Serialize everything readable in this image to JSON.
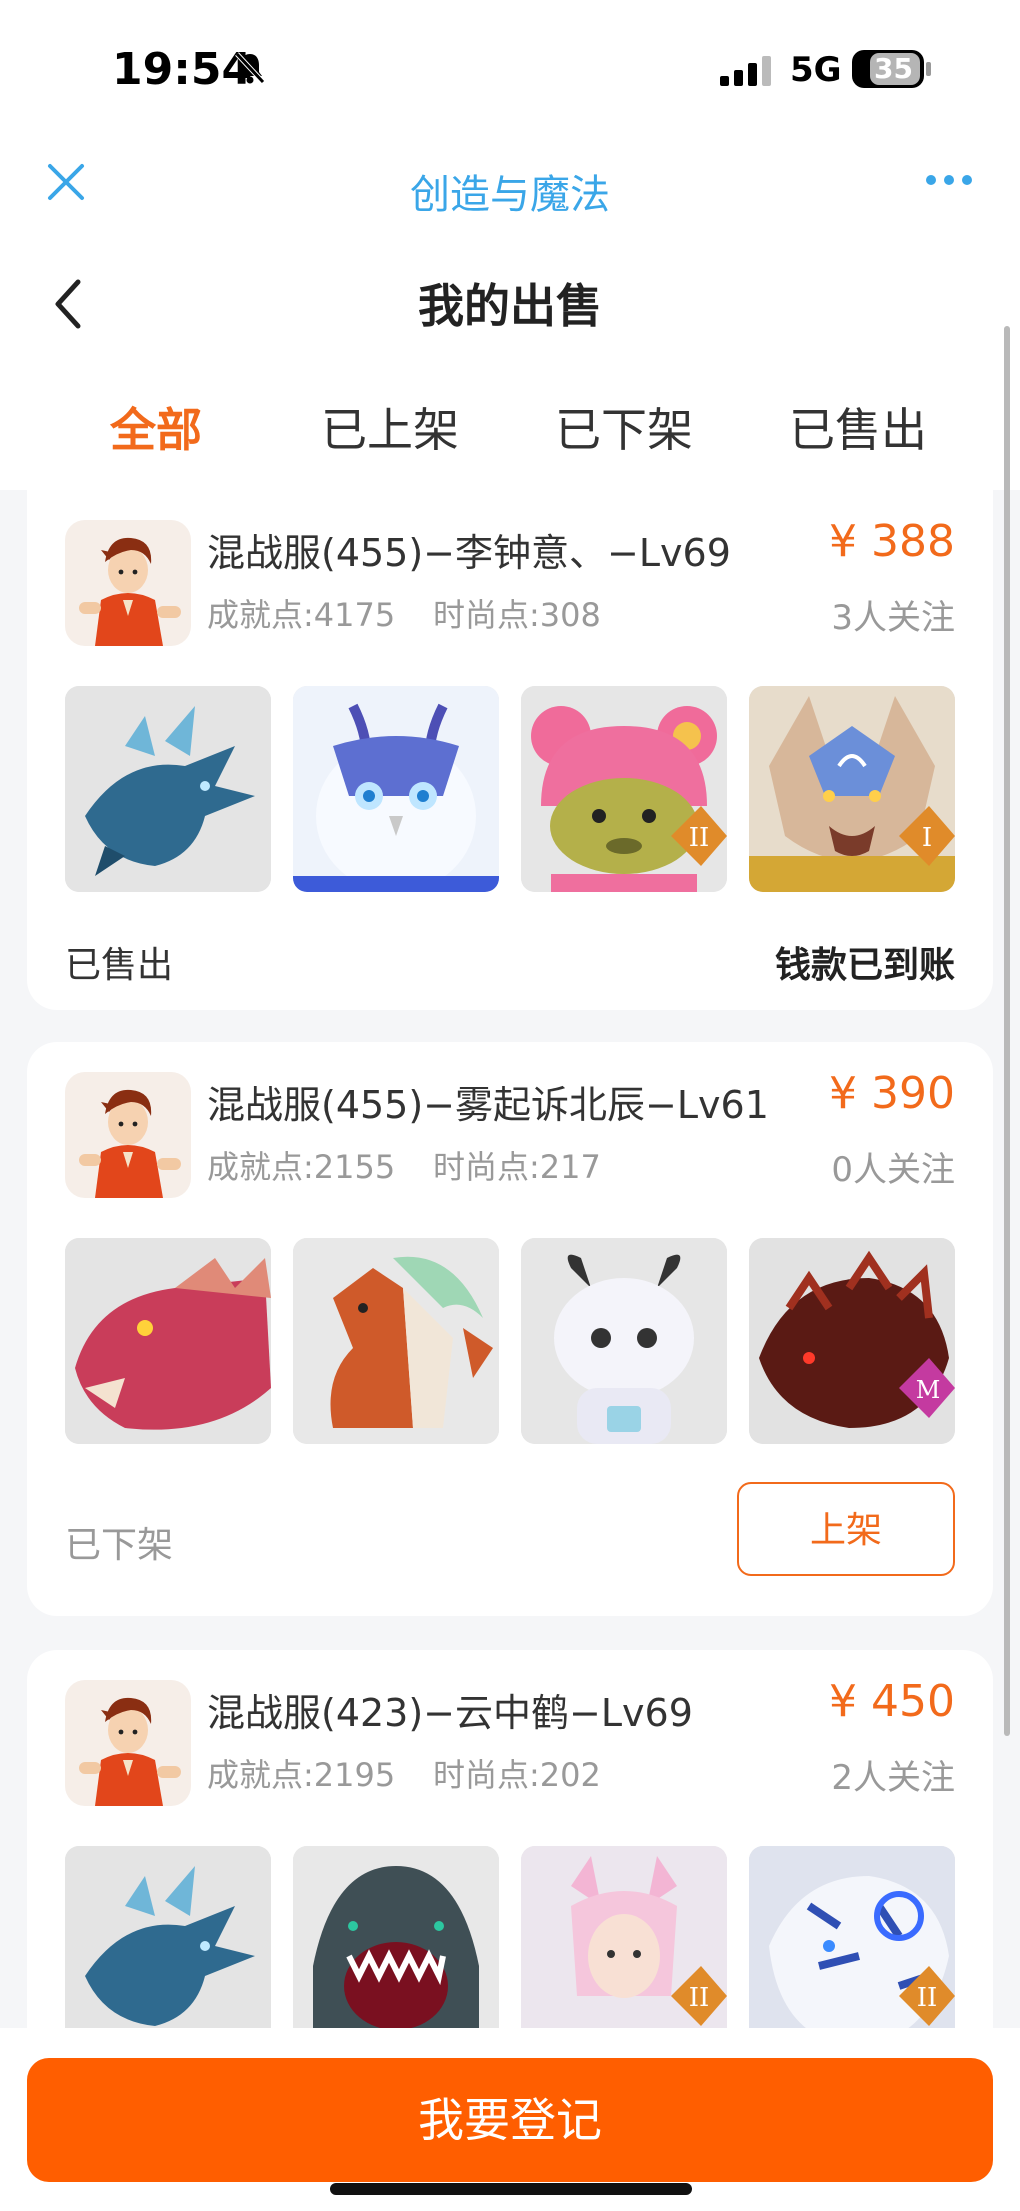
{
  "status_bar": {
    "time": "19:54",
    "network": "5G",
    "battery": "35"
  },
  "app": {
    "title": "创造与魔法"
  },
  "nav": {
    "title": "我的出售"
  },
  "tabs": [
    {
      "label": "全部",
      "active": true
    },
    {
      "label": "已上架",
      "active": false
    },
    {
      "label": "已下架",
      "active": false
    },
    {
      "label": "已售出",
      "active": false
    }
  ],
  "listings": [
    {
      "name": "混战服(455)−李钟意、−Lv69",
      "price": "¥ 388",
      "achievement": "成就点:4175",
      "fashion": "时尚点:308",
      "followers": "3人关注",
      "status": "已售出",
      "action": "钱款已到账",
      "thumbs": [
        "blue-dragon",
        "white-owl",
        "pink-bear-badge-II",
        "armored-wolf-badge-I"
      ]
    },
    {
      "name": "混战服(455)−雾起诉北辰−Lv61",
      "price": "¥ 390",
      "achievement": "成就点:2155",
      "fashion": "时尚点:217",
      "followers": "0人关注",
      "status": "已下架",
      "action": "上架",
      "thumbs": [
        "red-dragon",
        "orange-horse",
        "white-cow",
        "dark-red-beast-badge-M"
      ]
    },
    {
      "name": "混战服(423)−云中鹤−Lv69",
      "price": "¥ 450",
      "achievement": "成就点:2195",
      "fashion": "时尚点:202",
      "followers": "2人关注",
      "thumbs": [
        "blue-dragon",
        "shark",
        "pink-fox-girl-badge-II",
        "blue-tiger-badge-II"
      ]
    }
  ],
  "footer": {
    "register_label": "我要登记"
  },
  "colors": {
    "accent": "#f26a1b",
    "primary_button": "#ff5e00",
    "app_title": "#3aa6e8"
  }
}
